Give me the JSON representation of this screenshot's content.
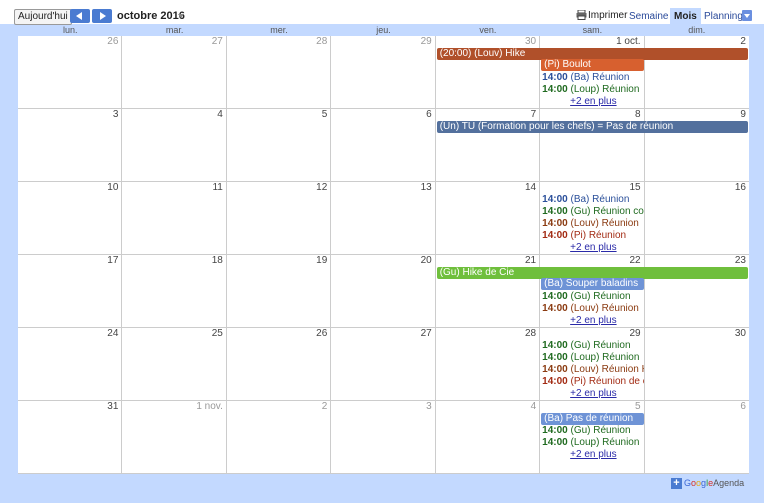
{
  "toolbar": {
    "today_label": "Aujourd'hui",
    "month_label": "octobre 2016",
    "print_label": "Imprimer",
    "views": {
      "week": "Semaine",
      "month": "Mois",
      "planning": "Planning"
    }
  },
  "weekdays": [
    "lun.",
    "mar.",
    "mer.",
    "jeu.",
    "ven.",
    "sam.",
    "dim."
  ],
  "colors": {
    "brown": "#b0502a",
    "orange": "#d7602f",
    "slate": "#53709d",
    "green": "#6fbf3c",
    "blue": "#6e93d6",
    "ev_blue_text": "#2a4f9a",
    "ev_green_text": "#1f6a1f",
    "ev_brown_text": "#8a3a10",
    "ev_red_text": "#a22a12"
  },
  "weeks": [
    {
      "days": [
        {
          "n": "26",
          "other": true
        },
        {
          "n": "27",
          "other": true
        },
        {
          "n": "28",
          "other": true
        },
        {
          "n": "29",
          "other": true
        },
        {
          "n": "30",
          "other": true
        },
        {
          "n": "1 oct.",
          "other": false
        },
        {
          "n": "2",
          "other": false
        }
      ],
      "bars": [
        {
          "text": "(20:00) (Louv) Hike",
          "start": 4,
          "span": 3,
          "color": "brown"
        },
        {
          "text": "(Pi) Boulot",
          "start": 5,
          "span": 1,
          "color": "orange"
        }
      ],
      "lines": [
        {
          "col": 5,
          "time": "14:00",
          "text": " (Ba) Réunion",
          "color": "ev_blue_text"
        },
        {
          "col": 5,
          "time": "14:00",
          "text": " (Loup) Réunion",
          "color": "ev_green_text"
        }
      ],
      "more": [
        {
          "col": 5,
          "text": "+2 en plus"
        }
      ]
    },
    {
      "days": [
        {
          "n": "3"
        },
        {
          "n": "4"
        },
        {
          "n": "5"
        },
        {
          "n": "6"
        },
        {
          "n": "7"
        },
        {
          "n": "8"
        },
        {
          "n": "9"
        }
      ],
      "bars": [
        {
          "text": "(Un) TU (Formation pour les chefs) = Pas de réunion",
          "start": 4,
          "span": 3,
          "color": "slate"
        }
      ],
      "lines": [],
      "more": []
    },
    {
      "days": [
        {
          "n": "10"
        },
        {
          "n": "11"
        },
        {
          "n": "12"
        },
        {
          "n": "13"
        },
        {
          "n": "14"
        },
        {
          "n": "15"
        },
        {
          "n": "16"
        }
      ],
      "bars": [],
      "lines": [
        {
          "col": 5,
          "time": "14:00",
          "text": " (Ba) Réunion",
          "color": "ev_blue_text"
        },
        {
          "col": 5,
          "time": "14:00",
          "text": " (Gu) Réunion cop",
          "color": "ev_green_text"
        },
        {
          "col": 5,
          "time": "14:00",
          "text": " (Louv) Réunion",
          "color": "ev_brown_text"
        },
        {
          "col": 5,
          "time": "14:00",
          "text": " (Pi) Réunion",
          "color": "ev_red_text"
        }
      ],
      "more": [
        {
          "col": 5,
          "text": "+2 en plus"
        }
      ]
    },
    {
      "days": [
        {
          "n": "17"
        },
        {
          "n": "18"
        },
        {
          "n": "19"
        },
        {
          "n": "20"
        },
        {
          "n": "21"
        },
        {
          "n": "22"
        },
        {
          "n": "23"
        }
      ],
      "bars": [
        {
          "text": "(Gu) Hike de Cie",
          "start": 4,
          "span": 3,
          "color": "green"
        },
        {
          "text": "(Ba) Souper baladins",
          "start": 5,
          "span": 1,
          "color": "blue"
        }
      ],
      "lines": [
        {
          "col": 5,
          "time": "14:00",
          "text": " (Gu) Réunion",
          "color": "ev_green_text"
        },
        {
          "col": 5,
          "time": "14:00",
          "text": " (Louv) Réunion",
          "color": "ev_brown_text"
        }
      ],
      "more": [
        {
          "col": 5,
          "text": "+2 en plus"
        }
      ]
    },
    {
      "days": [
        {
          "n": "24"
        },
        {
          "n": "25"
        },
        {
          "n": "26"
        },
        {
          "n": "27"
        },
        {
          "n": "28"
        },
        {
          "n": "29"
        },
        {
          "n": "30"
        }
      ],
      "bars": [],
      "lines": [
        {
          "col": 5,
          "time": "14:00",
          "text": " (Gu) Réunion",
          "color": "ev_green_text"
        },
        {
          "col": 5,
          "time": "14:00",
          "text": " (Loup) Réunion",
          "color": "ev_green_text"
        },
        {
          "col": 5,
          "time": "14:00",
          "text": " (Louv) Réunion H",
          "color": "ev_brown_text"
        },
        {
          "col": 5,
          "time": "14:00",
          "text": " (Pi) Réunion de c",
          "color": "ev_red_text"
        }
      ],
      "more": [
        {
          "col": 5,
          "text": "+2 en plus"
        }
      ]
    },
    {
      "days": [
        {
          "n": "31"
        },
        {
          "n": "1 nov.",
          "other": true
        },
        {
          "n": "2",
          "other": true
        },
        {
          "n": "3",
          "other": true
        },
        {
          "n": "4",
          "other": true
        },
        {
          "n": "5",
          "other": true
        },
        {
          "n": "6",
          "other": true
        }
      ],
      "bars": [
        {
          "text": "(Ba) Pas de réunion",
          "start": 5,
          "span": 1,
          "color": "blue"
        }
      ],
      "lines": [
        {
          "col": 5,
          "time": "14:00",
          "text": " (Gu) Réunion",
          "color": "ev_green_text"
        },
        {
          "col": 5,
          "time": "14:00",
          "text": " (Loup) Réunion",
          "color": "ev_green_text"
        }
      ],
      "more": [
        {
          "col": 5,
          "text": "+2 en plus"
        }
      ]
    }
  ],
  "footer": {
    "brand_parts": [
      "G",
      "o",
      "o",
      "g",
      "l",
      "e"
    ],
    "brand_suffix": "Agenda"
  }
}
